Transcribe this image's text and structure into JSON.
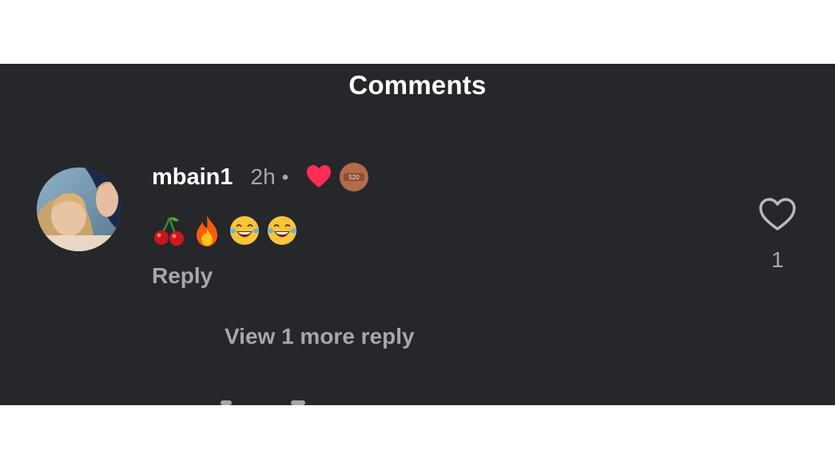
{
  "header": {
    "title": "Comments"
  },
  "comment": {
    "username": "mbain1",
    "time": "2h",
    "separator": "•",
    "badge_text": "520",
    "emojis": [
      "cherries",
      "fire",
      "face-with-tears-of-joy",
      "face-with-tears-of-joy"
    ],
    "reply_label": "Reply",
    "like_count": "1"
  },
  "replies": {
    "view_more_label": "View 1 more reply"
  },
  "colors": {
    "panel_bg": "#26272b",
    "text_primary": "#ffffff",
    "text_secondary": "#a6a7ab",
    "heart_red": "#ff2d55",
    "badge_bg": "#b46b4a"
  }
}
